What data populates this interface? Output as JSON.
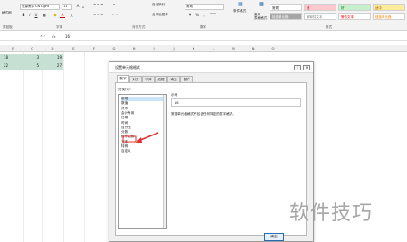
{
  "ribbon": {
    "clipboard": {
      "paste_format_label": "格式刷",
      "group_label": "剪贴板"
    },
    "font": {
      "font_name": "思源黑体 CN Light",
      "font_size": "11",
      "grow": "A",
      "shrink": "A",
      "bold": "B",
      "italic": "I",
      "underline": "U",
      "font_color": "A",
      "group_label": "字体"
    },
    "alignment": {
      "wrap_label": "自动换行",
      "merge_label": "合并后居中",
      "group_label": "对齐方式"
    },
    "number": {
      "format_value": "常规",
      "percent": "%",
      "comma": ",",
      "group_label": "数字"
    },
    "styles": {
      "cond_label": "条件格式",
      "table_label": "套用\n表格格式",
      "group_label": "样式",
      "boxes": [
        {
          "label": "常规",
          "bg": "#ffffff",
          "fg": "#222222"
        },
        {
          "label": "差",
          "bg": "#ffc7ce",
          "fg": "#9c0006"
        },
        {
          "label": "好",
          "bg": "#c6efce",
          "fg": "#006100"
        },
        {
          "label": "适中",
          "bg": "#ffeb9c",
          "fg": "#9c5700"
        },
        {
          "label": "检查单元格",
          "bg": "#a5a5a5",
          "fg": "#ffffff"
        },
        {
          "label": "解释性文本",
          "bg": "#ffffff",
          "fg": "#7f7f7f"
        },
        {
          "label": "警告文本",
          "bg": "#ffffff",
          "fg": "#ff0000"
        },
        {
          "label": "链接单元格",
          "bg": "#ffffff",
          "fg": "#fa7d00"
        }
      ]
    }
  },
  "formula_bar": {
    "value": "16",
    "fx": "fx"
  },
  "columns": [
    "B",
    "C",
    "D",
    "E",
    "F",
    "G",
    "H",
    "I",
    "J",
    "K",
    "L",
    "M",
    "N",
    "O"
  ],
  "cells": {
    "r1b": "18",
    "r1c": "3",
    "r1d": "19",
    "r2b": "22",
    "r2c": "5",
    "r2d": "27"
  },
  "dialog": {
    "title": "设置单元格格式",
    "help": "?",
    "close": "×",
    "tabs": [
      "数字",
      "对齐",
      "字体",
      "边框",
      "填充",
      "保护"
    ],
    "category_label": "分类(C):",
    "categories": [
      "常规",
      "数值",
      "货币",
      "会计专用",
      "日期",
      "时间",
      "百分比",
      "分数",
      "科学记数",
      "文本",
      "特殊",
      "自定义"
    ],
    "sample_label": "示例",
    "sample_value": "16",
    "description": "常规单元格格式不包含任何特定的数字格式。",
    "ok_label": "确定"
  },
  "watermark": "软件技巧",
  "colors": {
    "accent_green": "#217346",
    "selection": "#c6e0d4",
    "arrow": "#e03030"
  }
}
